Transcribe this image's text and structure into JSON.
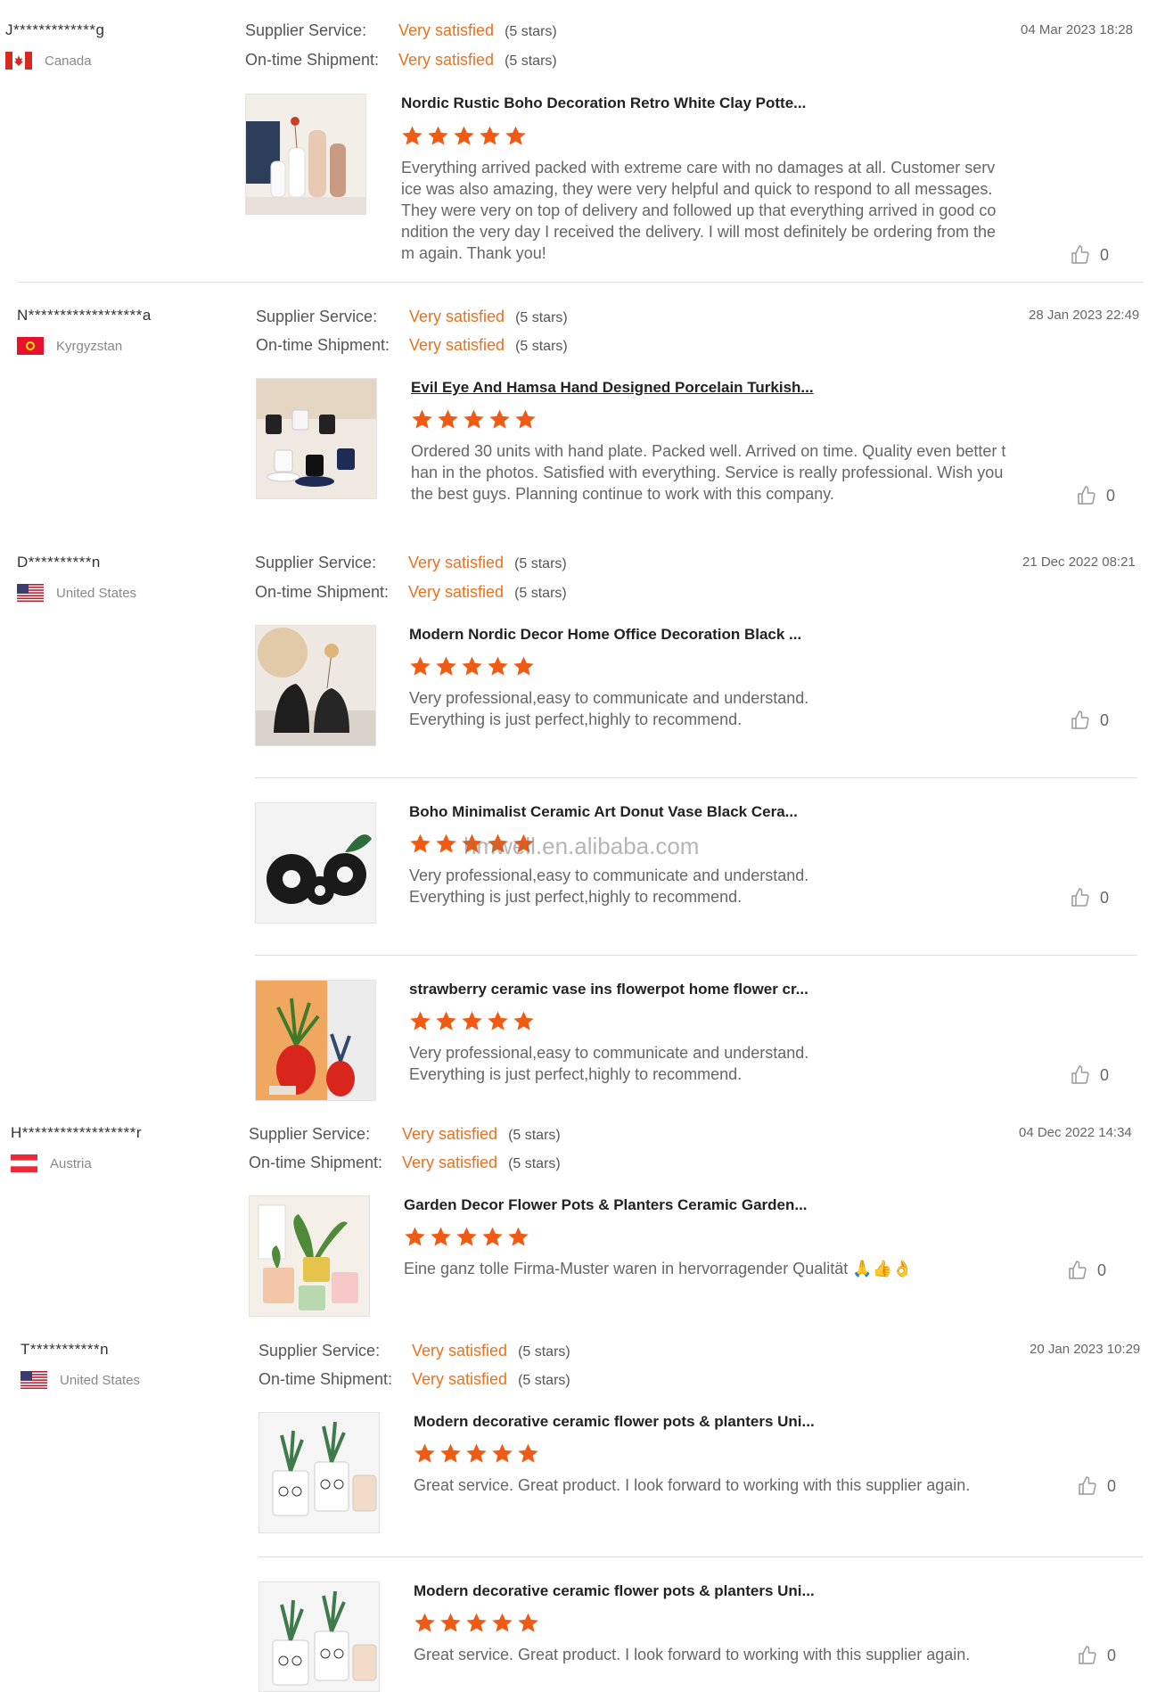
{
  "labels": {
    "supplier_service": "Supplier Service:",
    "on_time_shipment": "On-time Shipment:"
  },
  "watermark": "hmwell.en.alibaba.com",
  "colors": {
    "accent": "#e8721f",
    "star": "#f05a12"
  },
  "reviews": [
    {
      "user": "J*************g",
      "country": "Canada",
      "flag": "canada-flag",
      "supplier_service": "Very satisfied",
      "supplier_service_stars": "(5 stars)",
      "on_time_shipment": "Very satisfied",
      "on_time_shipment_stars": "(5 stars)",
      "date": "04 Mar 2023 18:28",
      "products": [
        {
          "title": "Nordic Rustic Boho Decoration Retro White Clay Potte...",
          "rating": 5,
          "text": "Everything arrived packed with extreme care with no damages at all.  Customer service was also amazing, they were very helpful and quick to respond to all messages.  They were very on top of delivery and followed up that everything arrived in good condition the very day I received the delivery.  I will most definitely be ordering from them again. Thank you!",
          "likes": "0"
        }
      ]
    },
    {
      "user": "N******************a",
      "country": "Kyrgyzstan",
      "flag": "kyrgyzstan-flag",
      "supplier_service": "Very satisfied",
      "supplier_service_stars": "(5 stars)",
      "on_time_shipment": "Very satisfied",
      "on_time_shipment_stars": "(5 stars)",
      "date": "28 Jan 2023 22:49",
      "products": [
        {
          "title": "Evil Eye And Hamsa Hand Designed Porcelain Turkish...",
          "rating": 5,
          "text": "Ordered 30 units with hand plate. Packed well. Arrived on time. Quality even better than in the photos. Satisfied with everything. Service is really professional. Wish you the best guys. Planning continue to work with this company.",
          "likes": "0"
        }
      ]
    },
    {
      "user": "D**********n",
      "country": "United States",
      "flag": "us-flag",
      "supplier_service": "Very satisfied",
      "supplier_service_stars": "(5 stars)",
      "on_time_shipment": "Very satisfied",
      "on_time_shipment_stars": "(5 stars)",
      "date": "21 Dec 2022 08:21",
      "products": [
        {
          "title": "Modern Nordic Decor Home Office Decoration Black ...",
          "rating": 5,
          "text": "Very professional,easy to communicate and understand.\nEverything is just perfect,highly to recommend.",
          "likes": "0"
        },
        {
          "title": "Boho Minimalist Ceramic Art Donut Vase Black Cera...",
          "rating": 5,
          "text": "Very professional,easy to communicate and understand.\nEverything is just perfect,highly to recommend.",
          "likes": "0"
        },
        {
          "title": "strawberry ceramic vase ins flowerpot home flower cr...",
          "rating": 5,
          "text": "Very professional,easy to communicate and understand.\nEverything is just perfect,highly to recommend.",
          "likes": "0"
        }
      ]
    },
    {
      "user": "H******************r",
      "country": "Austria",
      "flag": "austria-flag",
      "supplier_service": "Very satisfied",
      "supplier_service_stars": "(5 stars)",
      "on_time_shipment": "Very satisfied",
      "on_time_shipment_stars": "(5 stars)",
      "date": "04 Dec 2022 14:34",
      "products": [
        {
          "title": "Garden Decor Flower Pots & Planters Ceramic Garden...",
          "rating": 5,
          "text": "Eine ganz tolle Firma-Muster waren in hervorragender Qualität 🙏👍👌",
          "likes": "0"
        }
      ]
    },
    {
      "user": "T***********n",
      "country": "United States",
      "flag": "us-flag",
      "supplier_service": "Very satisfied",
      "supplier_service_stars": "(5 stars)",
      "on_time_shipment": "Very satisfied",
      "on_time_shipment_stars": "(5 stars)",
      "date": "20 Jan 2023 10:29",
      "products": [
        {
          "title": "Modern decorative ceramic flower pots & planters Uni...",
          "rating": 5,
          "text": "Great service. Great product.  I look forward to working with this supplier again.",
          "likes": "0"
        },
        {
          "title": "Modern decorative ceramic flower pots & planters Uni...",
          "rating": 5,
          "text": "Great service. Great product.  I look forward to working with this supplier again.",
          "likes": "0"
        }
      ]
    }
  ]
}
